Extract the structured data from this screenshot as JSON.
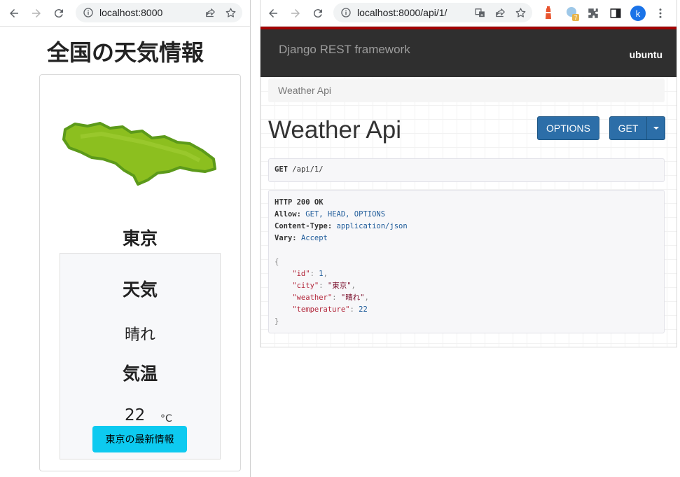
{
  "left_window": {
    "url": "localhost:8000",
    "heading": "全国の天気情報",
    "city": "東京",
    "weather_label": "天気",
    "weather_value": "晴れ",
    "temperature_label": "気温",
    "temperature_value": "22",
    "temperature_unit": "°C",
    "update_button": "東京の最新情報"
  },
  "right_window": {
    "url": "localhost:8000/api/1/",
    "avatar_letter": "k",
    "extension_badge": "7",
    "brand": "Django REST framework",
    "user": "ubuntu",
    "breadcrumb": "Weather Api",
    "title": "Weather Api",
    "options_button": "OPTIONS",
    "get_button": "GET",
    "request": {
      "method": "GET",
      "path": "/api/1/"
    },
    "response": {
      "status": "HTTP 200 OK",
      "allow_key": "Allow:",
      "allow_value": "GET, HEAD, OPTIONS",
      "content_type_key": "Content-Type:",
      "content_type_value": "application/json",
      "vary_key": "Vary:",
      "vary_value": "Accept",
      "json_lines": [
        {
          "key": "\"id\"",
          "value": "1",
          "kind": "num",
          "comma": ","
        },
        {
          "key": "\"city\"",
          "value": "\"東京\"",
          "kind": "str",
          "comma": ","
        },
        {
          "key": "\"weather\"",
          "value": "\"晴れ\"",
          "kind": "str",
          "comma": ","
        },
        {
          "key": "\"temperature\"",
          "value": "22",
          "kind": "num",
          "comma": ""
        }
      ],
      "open_brace": "{",
      "close_brace": "}"
    }
  },
  "colors": {
    "drf_accent": "#a30000",
    "drf_nav": "#2f2f2f",
    "primary_button": "#2c6ea8",
    "info_button": "#0dcaf0",
    "map_green": "#8cbf1f"
  },
  "icons": [
    "back-arrow-icon",
    "forward-arrow-icon",
    "reload-icon",
    "info-icon",
    "share-icon",
    "bookmark-star-icon",
    "translate-icon",
    "extension-icon",
    "side-panel-icon",
    "menu-icon"
  ]
}
